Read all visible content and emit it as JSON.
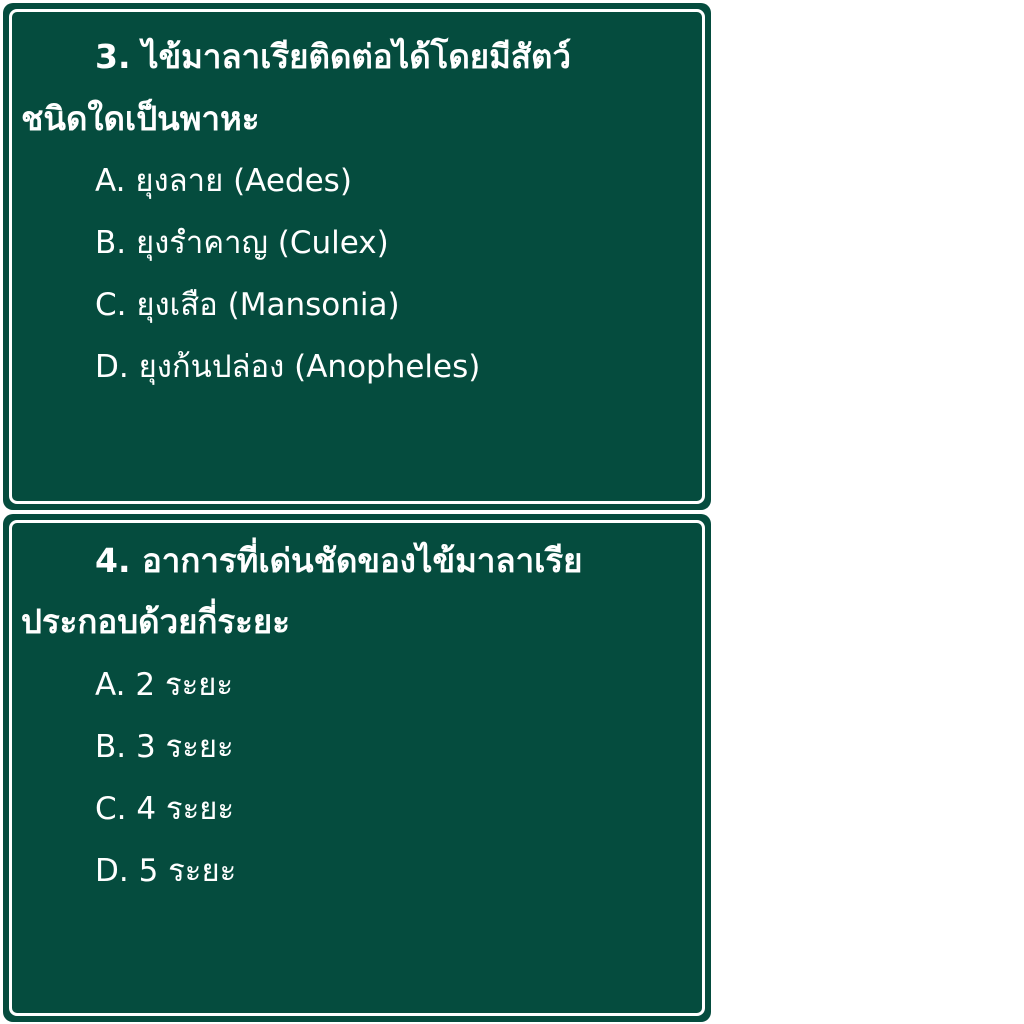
{
  "questions": [
    {
      "line1": "3. ไข้มาลาเรียติดต่อได้โดยมีสัตว์",
      "line2": "ชนิดใดเป็นพาหะ",
      "options": [
        "A. ยุงลาย (Aedes)",
        "B. ยุงรำคาญ (Culex)",
        "C. ยุงเสือ (Mansonia)",
        "D. ยุงก้นปล่อง (Anopheles)"
      ]
    },
    {
      "line1": "4. อาการที่เด่นชัดของไข้มาลาเรีย",
      "line2": "ประกอบด้วยกี่ระยะ",
      "options": [
        "A. 2 ระยะ",
        "B. 3 ระยะ",
        "C. 4 ระยะ",
        "D. 5 ระยะ"
      ]
    }
  ],
  "colors": {
    "card_background": "#054c3e",
    "border": "#ffffff",
    "text": "#ffffff"
  }
}
